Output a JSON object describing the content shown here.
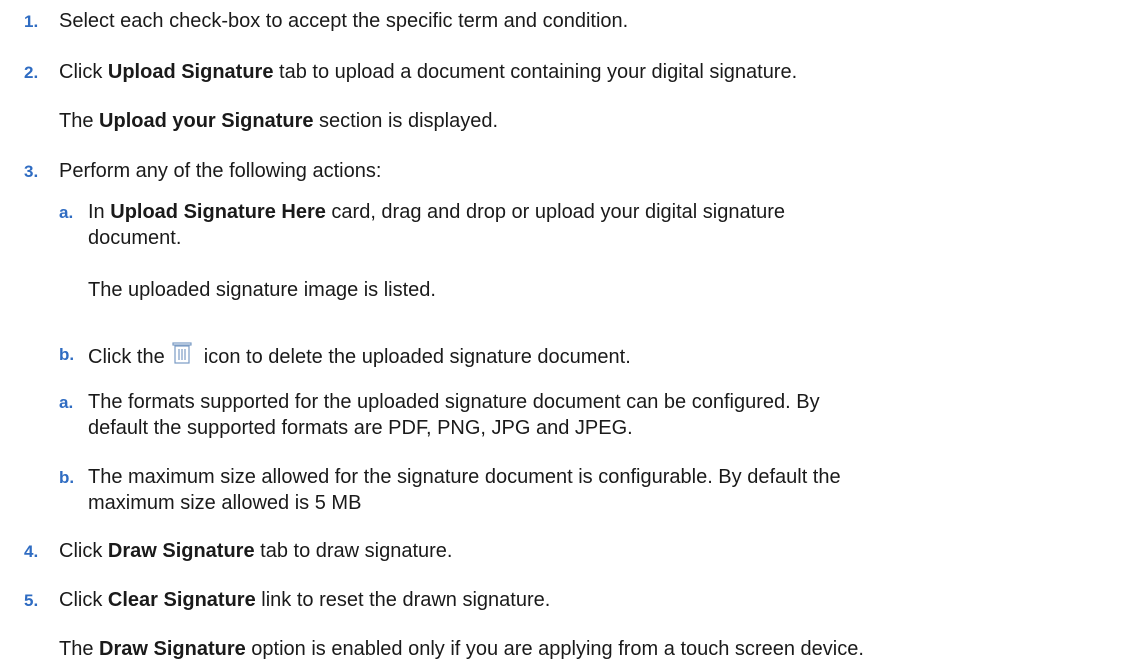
{
  "steps": [
    {
      "num": "1.",
      "text": "Select each check-box to accept the specific term and condition."
    },
    {
      "num": "2.",
      "pre": "Click ",
      "bold": "Upload Signature",
      "post": " tab to upload a document containing your digital signature."
    },
    {
      "num": "3.",
      "text": "Perform any of the following actions:"
    },
    {
      "num": "4.",
      "pre": "Click ",
      "bold": "Draw Signature",
      "post": " tab to draw signature."
    },
    {
      "num": "5.",
      "pre": "Click ",
      "bold": "Clear Signature",
      "post": " link to reset the drawn signature."
    }
  ],
  "step2_note": {
    "pre": "The ",
    "bold": "Upload your Signature",
    "post": " section is displayed."
  },
  "substeps": [
    {
      "letter": "a.",
      "pre": "In ",
      "bold": "Upload Signature Here",
      "post": " card, drag and drop or upload your digital signature",
      "line2": "document."
    },
    {
      "letter": "b.",
      "pre": "Click the ",
      "post": " icon to delete the uploaded signature document.",
      "icon": "trash-icon"
    },
    {
      "letter": "a.",
      "line1": "The formats supported for the uploaded signature document can be configured. By",
      "line2": "default the supported formats are PDF, PNG, JPG and JPEG."
    },
    {
      "letter": "b.",
      "line1": "The maximum size allowed for the signature document is configurable. By default the",
      "line2": "maximum size allowed is 5 MB"
    }
  ],
  "substep_a_note": "The uploaded signature image is listed.",
  "final_note": {
    "pre": "The ",
    "bold": "Draw Signature",
    "post": " option is enabled only if you are applying from a touch screen device."
  },
  "colors": {
    "number": "#2f6cc2",
    "text": "#1a1a1a",
    "icon": "#7a9bc4"
  }
}
